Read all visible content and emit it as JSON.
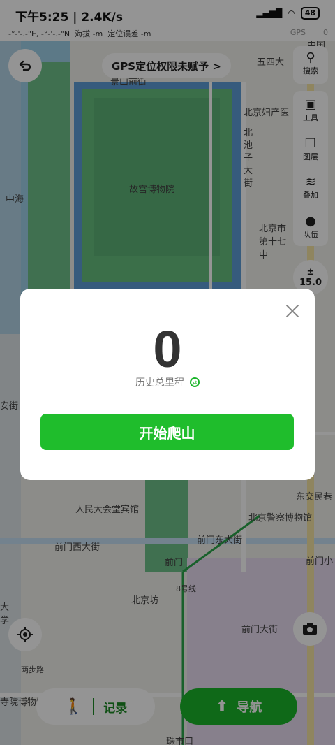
{
  "status_bar": {
    "time": "下午5:25",
    "speed": "2.4K/s",
    "battery": "48"
  },
  "location_bar": {
    "coords": "-°-'-.-\"E, -°-'-.-\"N",
    "altitude": "海拔 -m",
    "accuracy": "定位误差 -m",
    "gps_label": "GPS",
    "gps_value": "0"
  },
  "map": {
    "labels": {
      "forbidden_city": "故宫博物院",
      "wusi": "五四大",
      "beijing_maternity": "北京妇产医",
      "beichizi": "北池子大街",
      "zhonghai": "中海",
      "beijing_city_17": "北京市第十七中",
      "anjie": "安街",
      "jingshan": "景山前街",
      "people_hotel": "人民大会堂宾馆",
      "dongjiaomin": "东交民巷",
      "police_museum": "北京警察博物馆",
      "qianmen_west": "前门西大街",
      "qianmen_east": "前门东大街",
      "qianmen": "前门",
      "qianmen_small": "前门小",
      "beijingfang": "北京坊",
      "line8": "8号线",
      "qianmen_street": "前门大街",
      "liangbulu": "两步路",
      "museum": "寺院博物馆",
      "zhushikou": "珠市口",
      "daxue": "大学",
      "zhongguo": "中国"
    },
    "gps_banner": "GPS定位权限未赋予 >",
    "tools": {
      "search": "搜索",
      "tool": "工具",
      "layers": "图层",
      "overlay": "叠加",
      "team": "队伍"
    },
    "zoom_plus": "±",
    "zoom_level": "15.0",
    "record_label": "记录",
    "nav_label": "导航"
  },
  "dialog": {
    "total_value": "0",
    "total_label": "历史总里程",
    "start_button": "开始爬山"
  }
}
